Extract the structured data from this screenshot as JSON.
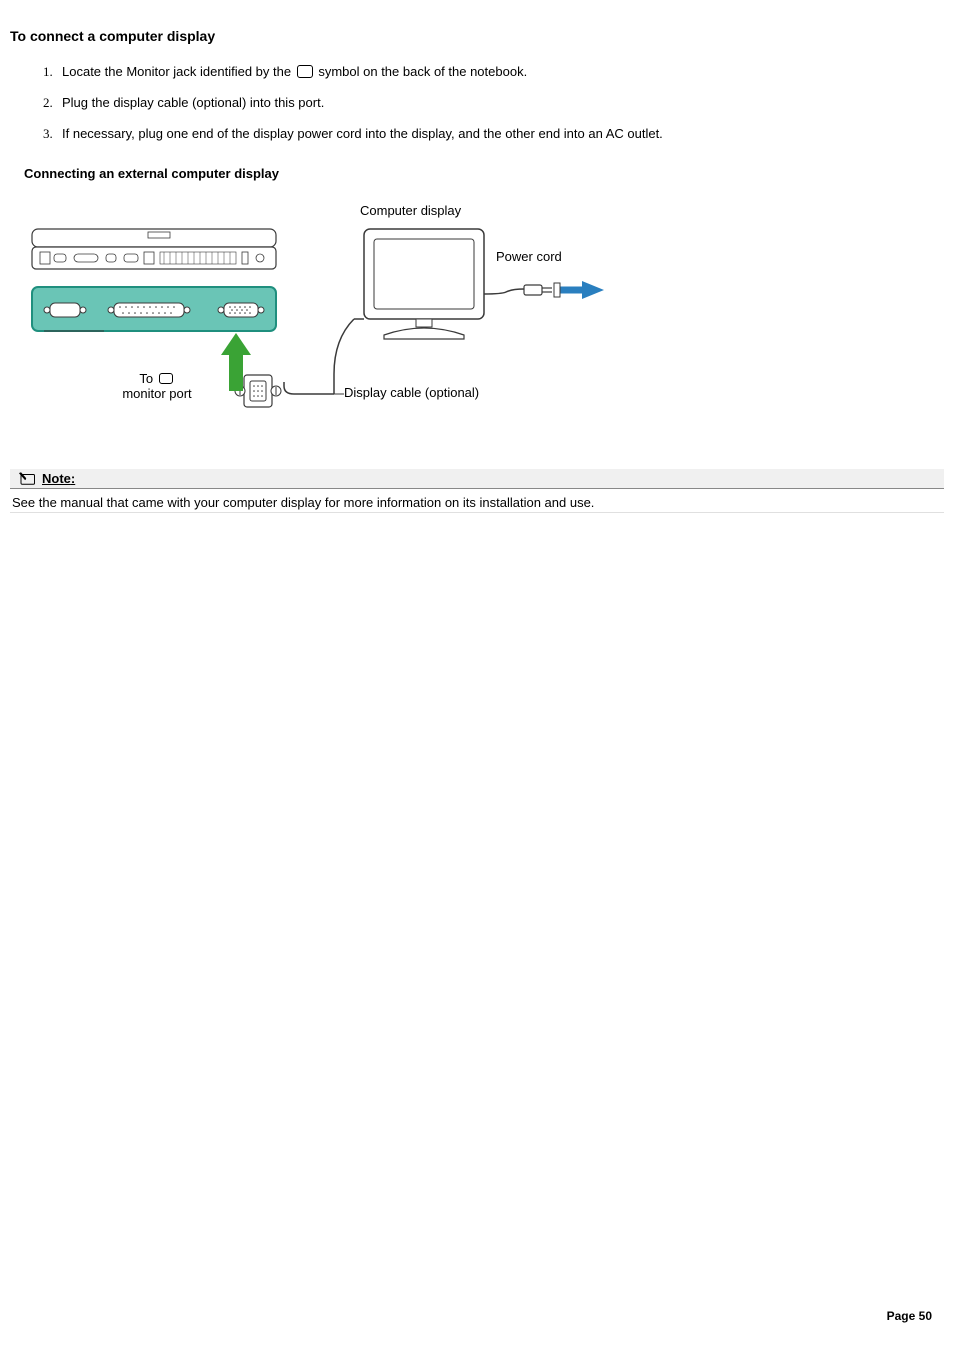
{
  "title": "To connect a computer display",
  "steps": {
    "item1_pre": "Locate the Monitor jack identified by the ",
    "item1_post": " symbol on the back of the notebook.",
    "item2": "Plug the display cable (optional) into this port.",
    "item3": "If necessary, plug one end of the display power cord into the display, and the other end into an AC outlet."
  },
  "sub_title": "Connecting an external computer display",
  "diagram": {
    "computer_display": "Computer display",
    "power_cord": "Power cord",
    "display_cable": "Display cable (optional)",
    "to_line1": "To",
    "to_line2": "monitor port",
    "monitor_icon_name": "monitor-icon"
  },
  "note": {
    "label": "Note",
    "colon": ":",
    "body": "See the manual that came with your computer display for more information on its installation and use."
  },
  "page_number": "Page 50"
}
